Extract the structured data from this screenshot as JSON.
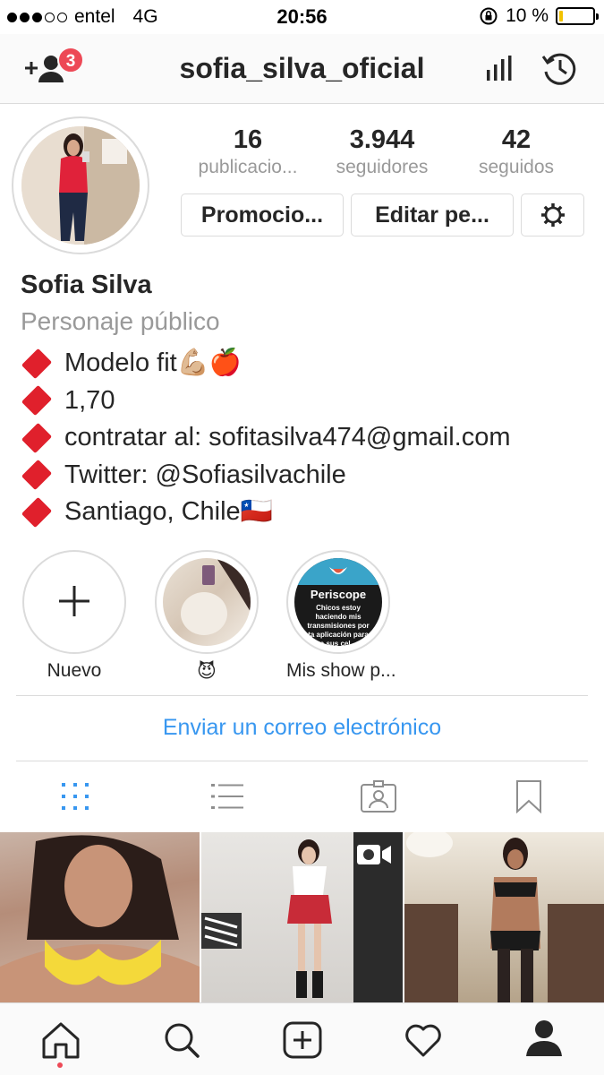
{
  "status_bar": {
    "carrier": "entel",
    "network": "4G",
    "time": "20:56",
    "battery_text": "10 %",
    "battery_level": 0.1,
    "signal_bars": 3
  },
  "header": {
    "username": "sofia_silva_oficial",
    "notification_count": "3"
  },
  "stats": {
    "posts": {
      "value": "16",
      "label": "publicacio..."
    },
    "followers": {
      "value": "3.944",
      "label": "seguidores"
    },
    "following": {
      "value": "42",
      "label": "seguidos"
    }
  },
  "buttons": {
    "promote": "Promocio...",
    "edit": "Editar pe..."
  },
  "profile": {
    "name": "Sofia Silva",
    "category": "Personaje público",
    "bio": [
      "Modelo fit💪🏼🍎",
      "1,70",
      "contratar al: sofitasilva474@gmail.com",
      "Twitter: @Sofiasilvachile",
      "Santiago, Chile🇨🇱"
    ]
  },
  "highlights": [
    {
      "label": "Nuevo"
    },
    {
      "label": "😈"
    },
    {
      "label": "Mis show p...",
      "title": "Periscope",
      "text": "Chicos estoy haciendo mis transmisiones por esta aplicación para ... a sus cel..."
    }
  ],
  "email_action": "Enviar un correo electrónico",
  "colors": {
    "accent": "#3897f0",
    "badge": "#ed4956",
    "diamond": "#e0202c",
    "battery": "#f2c200"
  },
  "icons": {
    "nav_left": "add-user-icon",
    "nav_right_1": "insights-icon",
    "nav_right_2": "archive-history-icon",
    "tabs": [
      "grid-icon",
      "list-icon",
      "tagged-icon",
      "saved-icon"
    ],
    "bottom": [
      "home-icon",
      "search-icon",
      "add-post-icon",
      "heart-icon",
      "profile-icon"
    ]
  }
}
